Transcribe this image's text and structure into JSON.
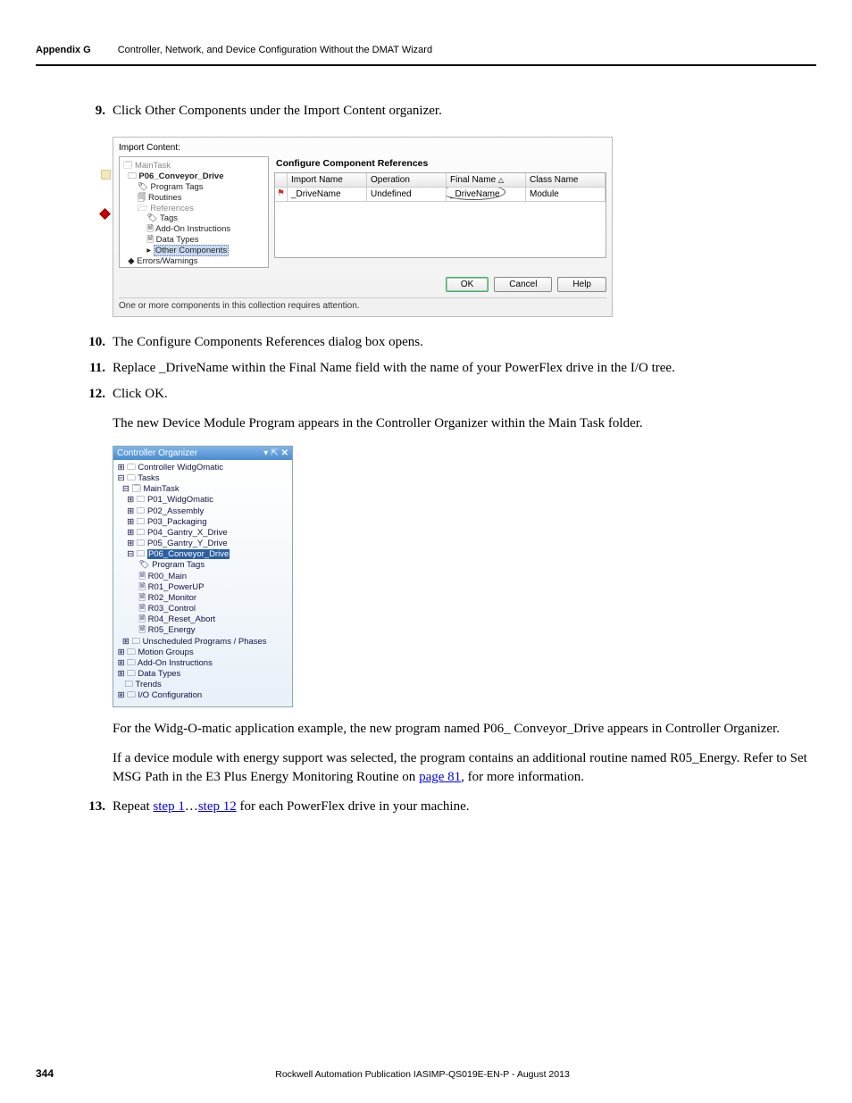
{
  "header": {
    "appendix": "Appendix G",
    "chapterTitle": "Controller, Network, and Device Configuration Without the DMAT Wizard"
  },
  "steps": {
    "s9": {
      "num": "9.",
      "text": "Click Other Components under the Import Content organizer."
    },
    "s10": {
      "num": "10.",
      "text": "The Configure Components References dialog box opens."
    },
    "s11": {
      "num": "11.",
      "text": "Replace _DriveName within the Final Name field with the name of your PowerFlex drive in the I/O tree."
    },
    "s12": {
      "num": "12.",
      "text": "Click OK."
    },
    "s13": {
      "num": "13.",
      "prefix": "Repeat ",
      "link1": "step 1",
      "mid": "…",
      "link2": "step 12",
      "suffix": " for each PowerFlex drive in your machine."
    }
  },
  "paragraphs": {
    "p1": "The new Device Module Program appears in the Controller Organizer within the Main Task folder.",
    "p2": "For the Widg-O-matic application example, the new program named P06_ Conveyor_Drive appears in Controller Organizer.",
    "p3": {
      "a": "If a device module with energy support was selected, the program contains an additional routine named R05_Energy. Refer to Set MSG Path in the E3 Plus Energy Monitoring Routine on ",
      "link": "page 81",
      "b": ", for more information."
    }
  },
  "dialog1": {
    "importLabel": "Import Content:",
    "tree": {
      "mainTask": "MainTask",
      "prog": "P06_Conveyor_Drive",
      "progTags": "Program Tags",
      "routines": "Routines",
      "references": "References",
      "tags": "Tags",
      "aoi": "Add-On Instructions",
      "dtypes": "Data Types",
      "other": "Other Components",
      "errors": "Errors/Warnings"
    },
    "refTitle": "Configure Component References",
    "headers": {
      "c1": "Import Name",
      "c2": "Operation",
      "c3": "Final Name",
      "c4": "Class Name"
    },
    "row": {
      "c1": "_DriveName",
      "c2": "Undefined",
      "c3": "_DriveName",
      "c4": "Module"
    },
    "buttons": {
      "ok": "OK",
      "cancel": "Cancel",
      "help": "Help"
    },
    "note": "One or more components in this collection requires attention."
  },
  "organizer": {
    "title": "Controller Organizer",
    "items": {
      "ctrl": "Controller WidgOmatic",
      "tasks": "Tasks",
      "mainTask": "MainTask",
      "p01": "P01_WidgOmatic",
      "p02": "P02_Assembly",
      "p03": "P03_Packaging",
      "p04": "P04_Gantry_X_Drive",
      "p05": "P05_Gantry_Y_Drive",
      "p06": "P06_Conveyor_Drive",
      "progTags": "Program Tags",
      "r00": "R00_Main",
      "r01": "R01_PowerUP",
      "r02": "R02_Monitor",
      "r03": "R03_Control",
      "r04": "R04_Reset_Abort",
      "r05": "R05_Energy",
      "unsched": "Unscheduled Programs / Phases",
      "motion": "Motion Groups",
      "addon": "Add-On Instructions",
      "dtypes": "Data Types",
      "trends": "Trends",
      "ioconf": "I/O Configuration"
    }
  },
  "footer": {
    "page": "344",
    "pub": "Rockwell Automation Publication IASIMP-QS019E-EN-P - August 2013"
  }
}
